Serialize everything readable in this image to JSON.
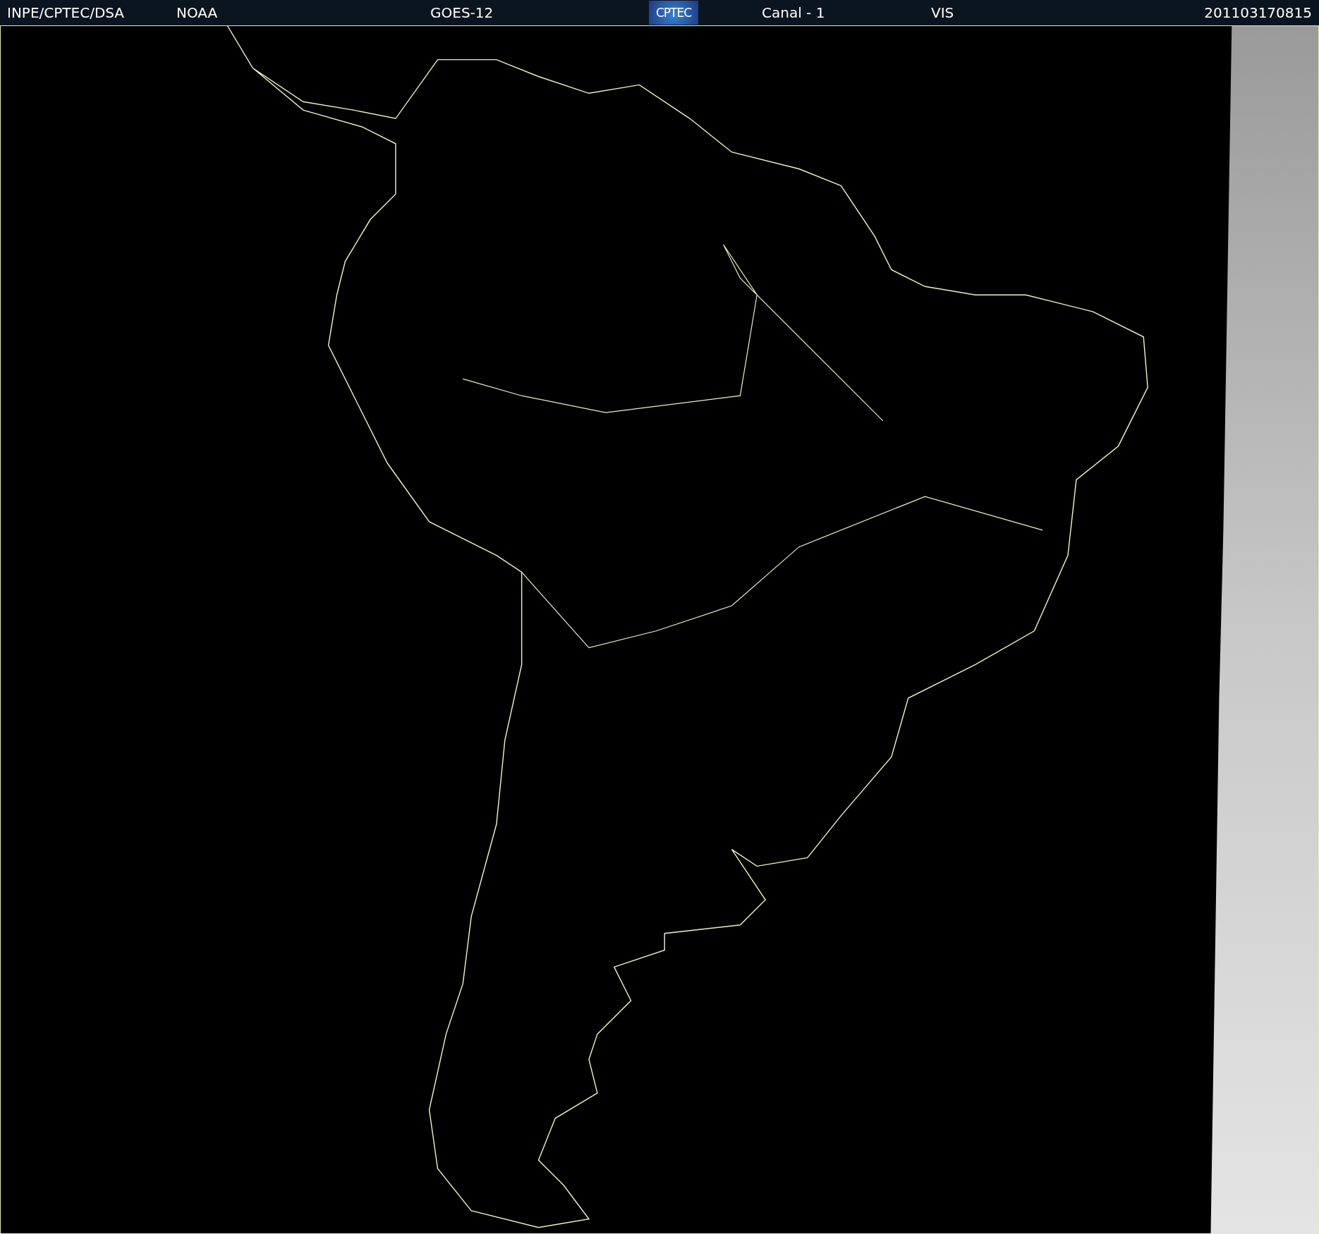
{
  "header": {
    "items": [
      {
        "kind": "text",
        "text": "INPE/CPTEC/DSA"
      },
      {
        "kind": "text",
        "text": "NOAA"
      },
      {
        "kind": "text",
        "text": "GOES-12"
      },
      {
        "kind": "logo",
        "text": "CPTEC"
      },
      {
        "kind": "text",
        "text": "Canal - 1"
      },
      {
        "kind": "text",
        "text": "VIS"
      },
      {
        "kind": "text",
        "text": "201103170815"
      }
    ]
  }
}
